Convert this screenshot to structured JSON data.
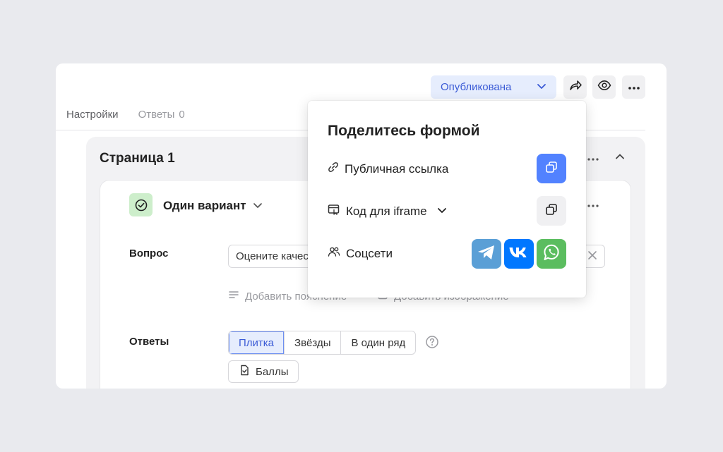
{
  "toolbar": {
    "status_label": "Опубликована",
    "icons": [
      "share-icon",
      "eye-icon",
      "more-icon"
    ]
  },
  "tabs": {
    "settings": "Настройки",
    "answers": "Ответы",
    "answers_count": "0"
  },
  "page": {
    "title": "Страница 1"
  },
  "question": {
    "type_label": "Один вариант",
    "question_label": "Вопрос",
    "question_value": "Оцените качес",
    "add_explanation": "Добавить пояснение",
    "add_image": "Добавить изображение",
    "answers_label": "Ответы",
    "answer_styles": [
      "Плитка",
      "Звёзды",
      "В один ряд"
    ],
    "selected_style": "Плитка",
    "points_label": "Баллы"
  },
  "share_popup": {
    "title": "Поделитесь формой",
    "public_link": "Публичная ссылка",
    "iframe_code": "Код для iframe",
    "social": "Соцсети",
    "social_icons": [
      "telegram-icon",
      "vk-icon",
      "whatsapp-icon"
    ]
  },
  "colors": {
    "accent": "#5282ff",
    "telegram": "#5a9fd6",
    "vk": "#0077ff",
    "whatsapp": "#5bbd5f"
  }
}
